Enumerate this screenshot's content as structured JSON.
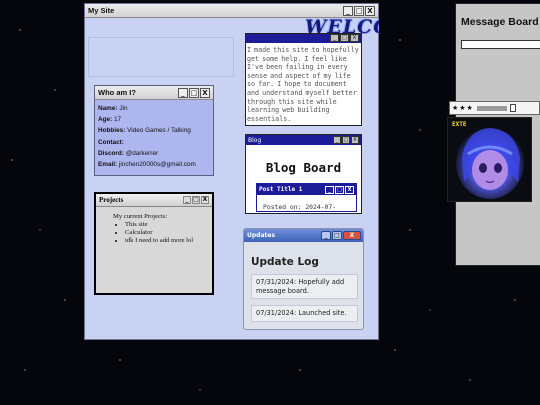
{
  "main_window": {
    "title": "My Site",
    "welcome_text": "WELCOME",
    "controls": [
      "_",
      "□",
      "X"
    ]
  },
  "about": {
    "title": "Who am I?",
    "controls": [
      "_",
      "□",
      "X"
    ],
    "fields": [
      {
        "label": "Name:",
        "value": "Jin"
      },
      {
        "label": "Age:",
        "value": "17"
      },
      {
        "label": "Hobbies:",
        "value": "Video Games / Talking"
      },
      {
        "label": "Contact:",
        "value": ""
      },
      {
        "label": "Discord:",
        "value": "@darkerrer"
      },
      {
        "label": "Email:",
        "value": "jinchen20000s@gmail.com"
      }
    ]
  },
  "projects": {
    "title": "Projects",
    "controls": [
      "_",
      "□",
      "X"
    ],
    "intro": "My current Projects:",
    "items": [
      "This site",
      "Calculator",
      "idk I need to add more lol"
    ]
  },
  "intro_window": {
    "controls": [
      "_",
      "□",
      "X"
    ],
    "text": "I made this site to hopefully get some help. I feel like I've been failing in every sense and aspect of my life so far. I hope to document and understand myself better through this site while learning web building essentials."
  },
  "blog": {
    "title": "Blog",
    "controls": [
      "_",
      "□",
      "X"
    ],
    "heading": "Blog Board",
    "post": {
      "title": "Post Title 1",
      "controls": [
        "_",
        "□",
        "X"
      ],
      "meta": "Posted on: 2024-07-"
    }
  },
  "updates": {
    "title": "Updates",
    "controls": [
      "_",
      "□",
      "X"
    ],
    "heading": "Update Log",
    "items": [
      "07/31/2024: Hopefully add message board.",
      "07/31/2024: Launched site."
    ]
  },
  "message_board": {
    "title": "Message Board",
    "input_value": ""
  },
  "side_strip": {
    "stars": "★★★"
  },
  "art": {
    "label": "EXTE"
  },
  "colors": {
    "navy_titlebar": "#1c1c99",
    "main_bg": "#c9d2f2",
    "about_bg": "#aeb6ef",
    "space_bg": "#05060c"
  }
}
